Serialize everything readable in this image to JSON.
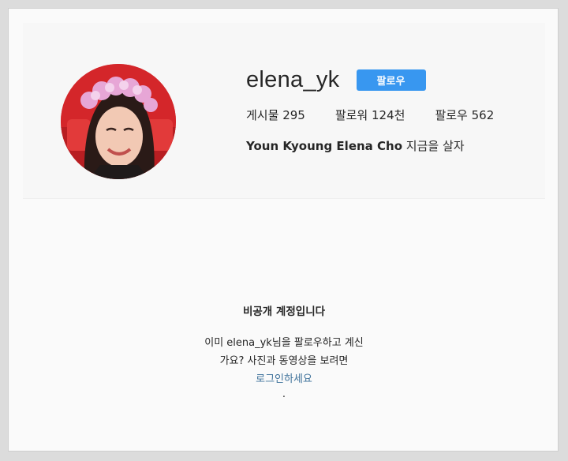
{
  "profile": {
    "username": "elena_yk",
    "follow_label": "팔로우",
    "stats": [
      {
        "label": "게시물",
        "value": "295"
      },
      {
        "label": "팔로워",
        "value": "124천"
      },
      {
        "label": "팔로우",
        "value": "562"
      }
    ],
    "bio_name": "Youn Kyoung Elena Cho",
    "bio_text": "지금을 살자"
  },
  "private_notice": {
    "title": "비공개 계정입니다",
    "line1": "이미 elena_yk님을 팔로우하고 계신",
    "line2": "가요? 사진과 동영상을 보려면",
    "login_link": "로그인하세요",
    "trailing": "."
  },
  "colors": {
    "follow_button": "#3897f0",
    "link": "#3f729b"
  }
}
